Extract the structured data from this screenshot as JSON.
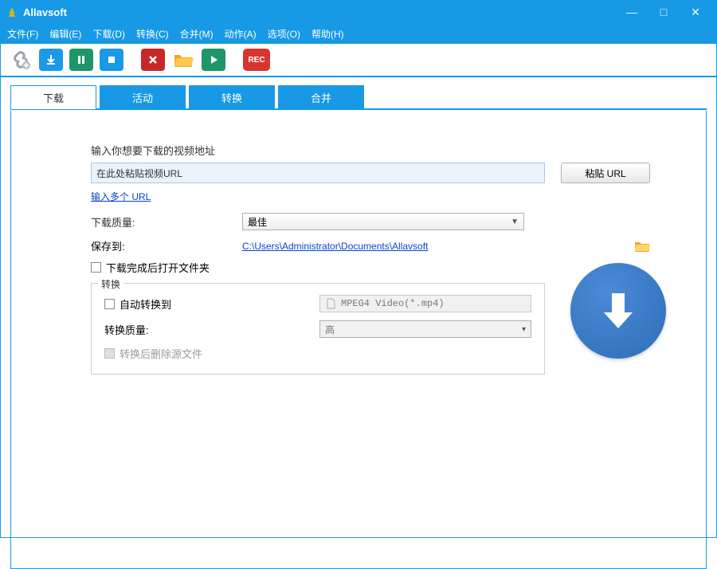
{
  "window": {
    "title": "Allavsoft"
  },
  "menu": {
    "file": "文件(F)",
    "edit": "编辑(E)",
    "download": "下载(D)",
    "convert": "转换(C)",
    "merge": "合并(M)",
    "action": "动作(A)",
    "option": "选项(O)",
    "help": "帮助(H)"
  },
  "tabs": {
    "download": "下载",
    "activity": "活动",
    "convert": "转换",
    "merge": "合并"
  },
  "main": {
    "prompt": "输入你想要下载的视频地址",
    "url_value": "在此处粘贴视频URL",
    "paste_btn": "粘贴 URL",
    "multi_url_link": "输入多个 URL",
    "quality_label": "下载质量:",
    "quality_value": "最佳",
    "saveto_label": "保存到:",
    "saveto_path": "C:\\Users\\Administrator\\Documents\\Allavsoft",
    "open_after": "下载完成后打开文件夹",
    "convert_legend": "转换",
    "auto_convert": "自动转换到",
    "format_value": "MPEG4 Video(*.mp4)",
    "convert_quality_label": "转换质量:",
    "convert_quality_value": "高",
    "delete_source": "转换后删除源文件"
  }
}
